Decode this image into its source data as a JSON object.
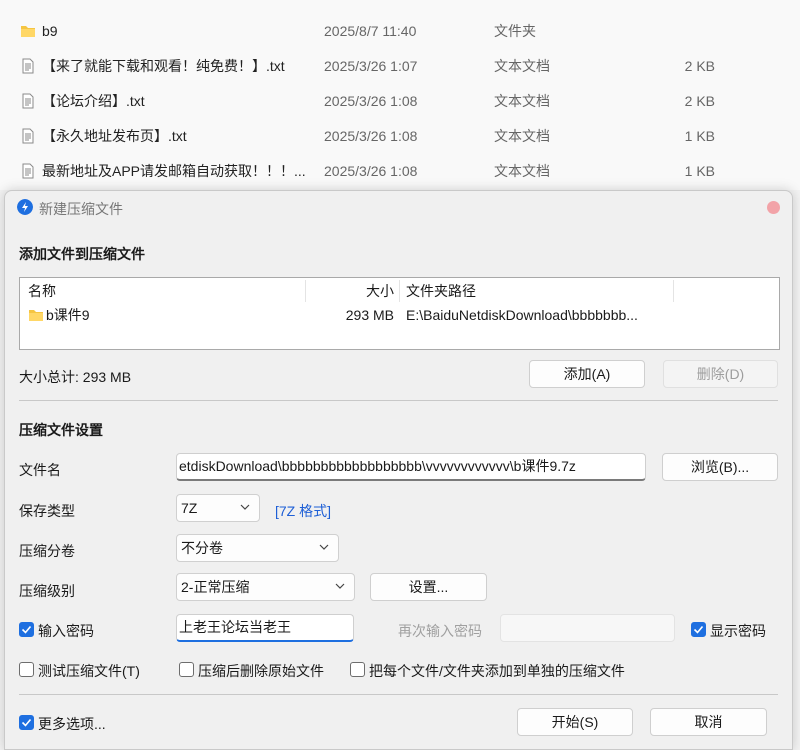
{
  "explorer": {
    "files": [
      {
        "name": "b9",
        "date": "2025/8/7 11:40",
        "type": "文件夹",
        "size": "",
        "kind": "folder"
      },
      {
        "name": "【来了就能下载和观看！纯免费！】.txt",
        "date": "2025/3/26 1:07",
        "type": "文本文档",
        "size": "2 KB",
        "kind": "file"
      },
      {
        "name": "【论坛介绍】.txt",
        "date": "2025/3/26 1:08",
        "type": "文本文档",
        "size": "2 KB",
        "kind": "file"
      },
      {
        "name": "【永久地址发布页】.txt",
        "date": "2025/3/26 1:08",
        "type": "文本文档",
        "size": "1 KB",
        "kind": "file"
      },
      {
        "name": "最新地址及APP请发邮箱自动获取！！！...",
        "date": "2025/3/26 1:08",
        "type": "文本文档",
        "size": "1 KB",
        "kind": "file"
      }
    ]
  },
  "dialog": {
    "title": "新建压缩文件",
    "add_section_title": "添加文件到压缩文件",
    "list_headers": {
      "name": "名称",
      "size": "大小",
      "path": "文件夹路径"
    },
    "list_items": [
      {
        "name": "b课件9",
        "size": "293 MB",
        "path": "E:\\BaiduNetdiskDownload\\bbbbbbb..."
      }
    ],
    "total_size": "大小总计: 293 MB",
    "add_button": "添加(A)",
    "delete_button": "删除(D)",
    "settings_section_title": "压缩文件设置",
    "filename_label": "文件名",
    "filename_value": "etdiskDownload\\bbbbbbbbbbbbbbbbbb\\vvvvvvvvvvvv\\b课件9.7z",
    "browse_button": "浏览(B)...",
    "save_type_label": "保存类型",
    "save_type_value": "7Z",
    "format_link": "[7Z 格式]",
    "split_label": "压缩分卷",
    "split_value": "不分卷",
    "level_label": "压缩级别",
    "level_value": "2-正常压缩",
    "level_settings_button": "设置...",
    "password_checkbox": "输入密码",
    "password_checked": true,
    "password_value": "上老王论坛当老王",
    "reenter_label": "再次输入密码",
    "reenter_value": "",
    "show_password": "显示密码",
    "show_password_checked": true,
    "test_checkbox": "测试压缩文件(T)",
    "delete_after_checkbox": "压缩后删除原始文件",
    "each_file_checkbox": "把每个文件/文件夹添加到单独的压缩文件",
    "more_options": "更多选项...",
    "more_options_checked": true,
    "start_button": "开始(S)",
    "cancel_button": "取消"
  }
}
